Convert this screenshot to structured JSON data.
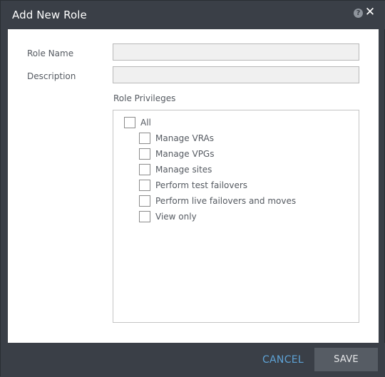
{
  "dialog": {
    "title": "Add New Role",
    "help_icon": "question-circle-icon",
    "close_icon": "close-icon",
    "help_glyph": "?",
    "close_glyph": "✕"
  },
  "form": {
    "role_name_label": "Role Name",
    "role_name_value": "",
    "description_label": "Description",
    "description_value": "",
    "privileges_label": "Role Privileges"
  },
  "privileges": {
    "all_label": "All",
    "items": [
      "Manage VRAs",
      "Manage VPGs",
      "Manage sites",
      "Perform test failovers",
      "Perform live failovers and moves",
      "View only"
    ]
  },
  "footer": {
    "cancel_label": "CANCEL",
    "save_label": "SAVE"
  },
  "colors": {
    "frame": "#3a3f47",
    "content_bg": "#ffffff",
    "label_text": "#555a61",
    "cancel_link": "#5ea3d6",
    "save_button_bg": "#565c64"
  }
}
